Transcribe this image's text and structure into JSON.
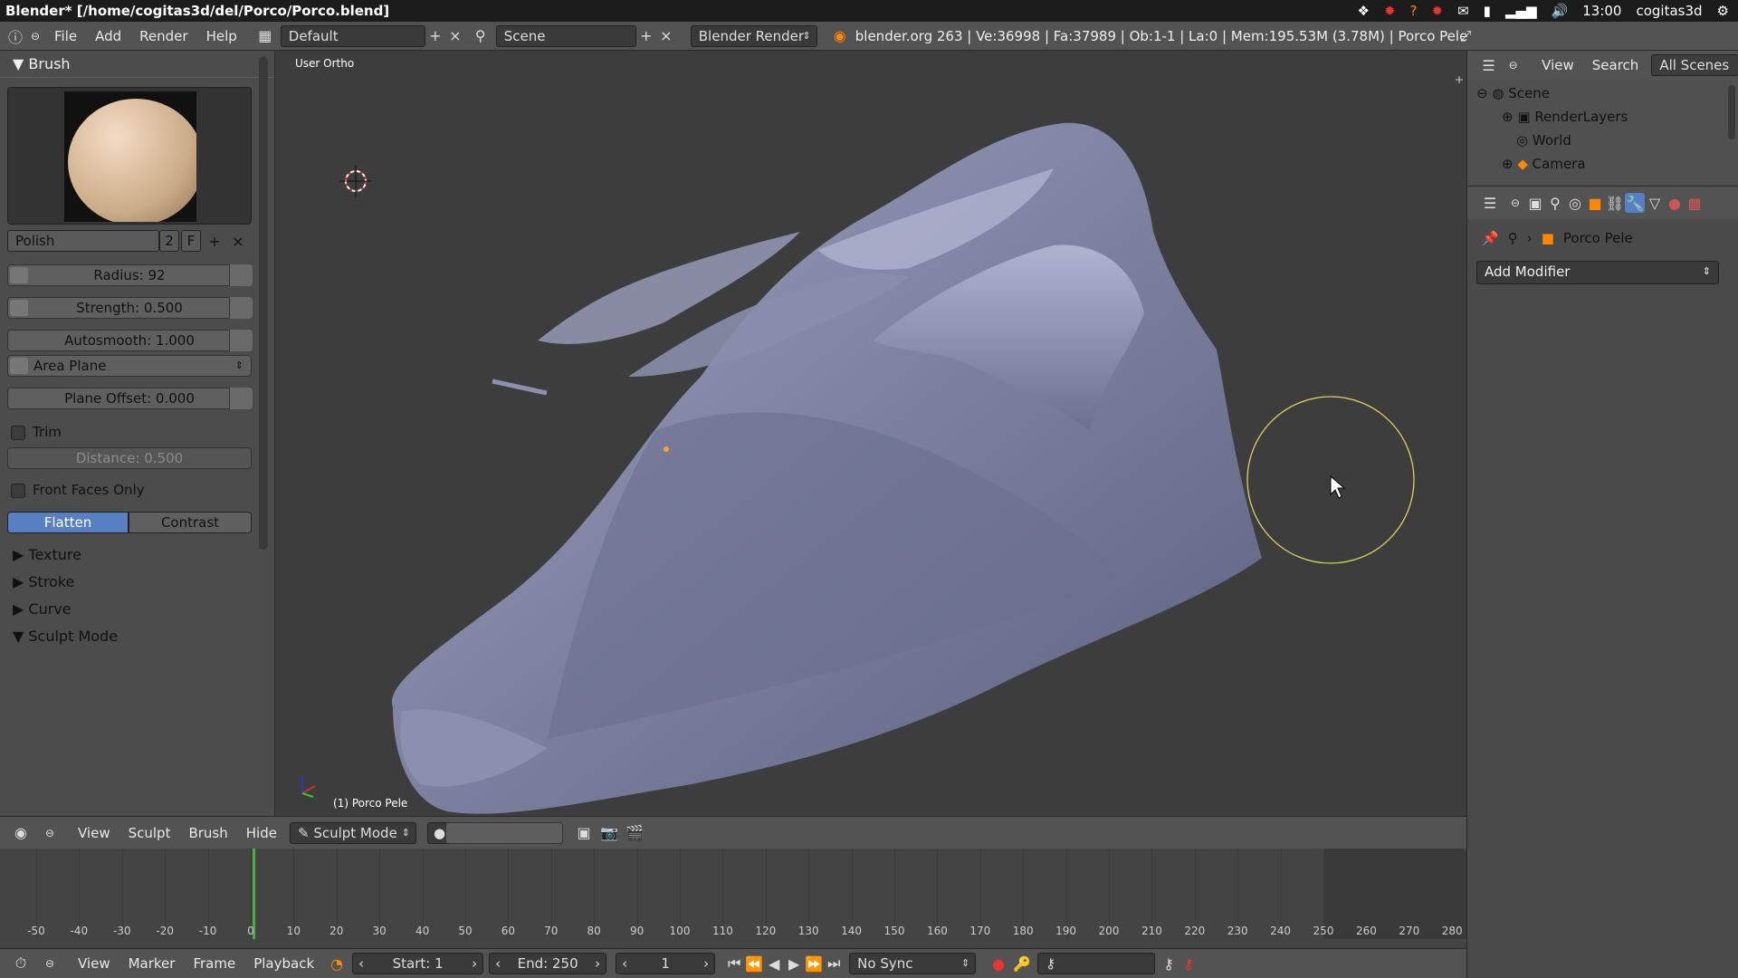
{
  "window": {
    "title": "Blender* [/home/cogitas3d/del/Porco/Porco.blend]"
  },
  "system": {
    "time": "13:00",
    "user": "cogitas3d"
  },
  "topbar": {
    "menus": [
      "File",
      "Add",
      "Render",
      "Help"
    ],
    "layout": "Default",
    "scene": "Scene",
    "engine": "Blender Render",
    "stats": "blender.org 263 | Ve:36998 | Fa:37989 | Ob:1-1 | La:0 | Mem:195.53M (3.78M) | Porco Pele"
  },
  "leftpanel": {
    "brush_header": "Brush",
    "brush_name": "Polish",
    "brush_users": "2",
    "brush_fake": "F",
    "radius": "Radius: 92",
    "strength": "Strength: 0.500",
    "autosmooth": "Autosmooth: 1.000",
    "plane": "Area Plane",
    "plane_offset": "Plane Offset: 0.000",
    "trim": "Trim",
    "distance": "Distance: 0.500",
    "front_faces": "Front Faces Only",
    "flatten": "Flatten",
    "contrast": "Contrast",
    "sections": [
      "Texture",
      "Stroke",
      "Curve"
    ],
    "sculpt_mode": "Sculpt Mode"
  },
  "viewport": {
    "label": "User Ortho",
    "object": "(1) Porco Pele"
  },
  "vphead": {
    "menus": [
      "View",
      "Sculpt",
      "Brush",
      "Hide"
    ],
    "mode": "Sculpt Mode"
  },
  "rightpanel": {
    "outliner_view": "View",
    "outliner_search": "Search",
    "outliner_filter": "All Scenes",
    "tree": [
      "Scene",
      "RenderLayers",
      "World",
      "Camera"
    ],
    "object": "Porco Pele",
    "modifier": "Add Modifier"
  },
  "timeline": {
    "ticks": [
      "-50",
      "-40",
      "-30",
      "-20",
      "-10",
      "0",
      "10",
      "20",
      "30",
      "40",
      "50",
      "60",
      "70",
      "80",
      "90",
      "100",
      "110",
      "120",
      "130",
      "140",
      "150",
      "160",
      "170",
      "180",
      "190",
      "200",
      "210",
      "220",
      "230",
      "240",
      "250",
      "260",
      "270",
      "280"
    ],
    "current": "1"
  },
  "tlfoot": {
    "menus": [
      "View",
      "Marker",
      "Frame",
      "Playback"
    ],
    "start": "Start: 1",
    "end": "End: 250",
    "frame": "1",
    "sync": "No Sync"
  }
}
